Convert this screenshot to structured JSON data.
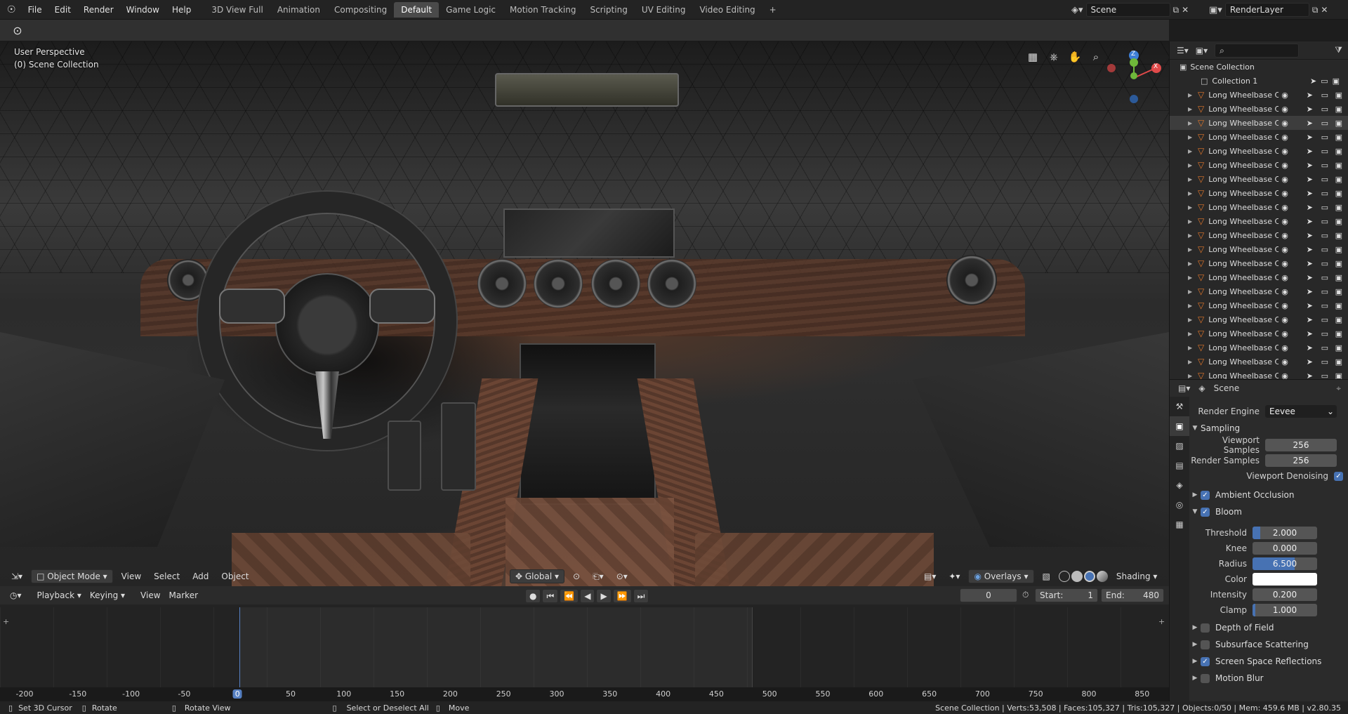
{
  "topbar": {
    "menus": [
      "File",
      "Edit",
      "Render",
      "Window",
      "Help"
    ],
    "workspaces": [
      "3D View Full",
      "Animation",
      "Compositing",
      "Default",
      "Game Logic",
      "Motion Tracking",
      "Scripting",
      "UV Editing",
      "Video Editing"
    ],
    "active_workspace": "Default",
    "add_tab": "+",
    "scene": "Scene",
    "view_layer": "RenderLayer"
  },
  "viewport": {
    "perspective": "User Perspective",
    "collection": "(0) Scene Collection",
    "mode": "Object Mode",
    "menus": [
      "View",
      "Select",
      "Add",
      "Object"
    ],
    "transform": "Global",
    "overlays": "Overlays",
    "shading": "Shading",
    "gizmo_axes": [
      "Z",
      "Y",
      "X"
    ],
    "nav_icons": [
      "grid-view-icon",
      "camera-view-icon",
      "hand-pan-icon",
      "zoom-icon"
    ]
  },
  "timeline": {
    "menus": [
      "Playback",
      "Keying",
      "View",
      "Marker"
    ],
    "current_frame": "0",
    "start_label": "Start:",
    "start": "1",
    "end_label": "End:",
    "end": "480",
    "ruler": [
      "-200",
      "-150",
      "-100",
      "-50",
      "0",
      "50",
      "100",
      "150",
      "200",
      "250",
      "300",
      "350",
      "400",
      "450",
      "500",
      "550",
      "600",
      "650",
      "700",
      "750",
      "800",
      "850"
    ]
  },
  "outliner": {
    "root": "Scene Collection",
    "collection": "Collection 1",
    "object_name": "Long Wheelbase Car",
    "rows": 21,
    "selected_row": 3
  },
  "properties": {
    "header": "Scene",
    "render_engine_label": "Render Engine",
    "render_engine": "Eevee",
    "sampling": {
      "title": "Sampling",
      "viewport_samples_label": "Viewport Samples",
      "viewport_samples": "256",
      "render_samples_label": "Render Samples",
      "render_samples": "256",
      "denoise_label": "Viewport Denoising",
      "denoise": true
    },
    "ambient_occlusion": {
      "title": "Ambient Occlusion",
      "enabled": true
    },
    "bloom": {
      "title": "Bloom",
      "enabled": true,
      "threshold_label": "Threshold",
      "threshold": "2.000",
      "knee_label": "Knee",
      "knee": "0.000",
      "radius_label": "Radius",
      "radius": "6.500",
      "color_label": "Color",
      "color": "#ffffff",
      "intensity_label": "Intensity",
      "intensity": "0.200",
      "clamp_label": "Clamp",
      "clamp": "1.000"
    },
    "panels": [
      {
        "title": "Depth of Field",
        "enabled": false
      },
      {
        "title": "Subsurface Scattering",
        "enabled": false
      },
      {
        "title": "Screen Space Reflections",
        "enabled": true
      },
      {
        "title": "Motion Blur",
        "enabled": false
      }
    ]
  },
  "status": {
    "left": [
      "Set 3D Cursor",
      "Rotate",
      "Rotate View",
      "Select or Deselect All",
      "Move"
    ],
    "right": "Scene Collection | Verts:53,508 | Faces:105,327 | Tris:105,327 | Objects:0/50 | Mem: 459.6 MB | v2.80.35"
  },
  "colors": {
    "accent": "#4772b3",
    "active_frame": "#5680c2",
    "selected_orange": "#e2762a",
    "x_axis": "#e04a4a",
    "y_axis": "#6fb93a",
    "z_axis": "#3d7fd6"
  }
}
